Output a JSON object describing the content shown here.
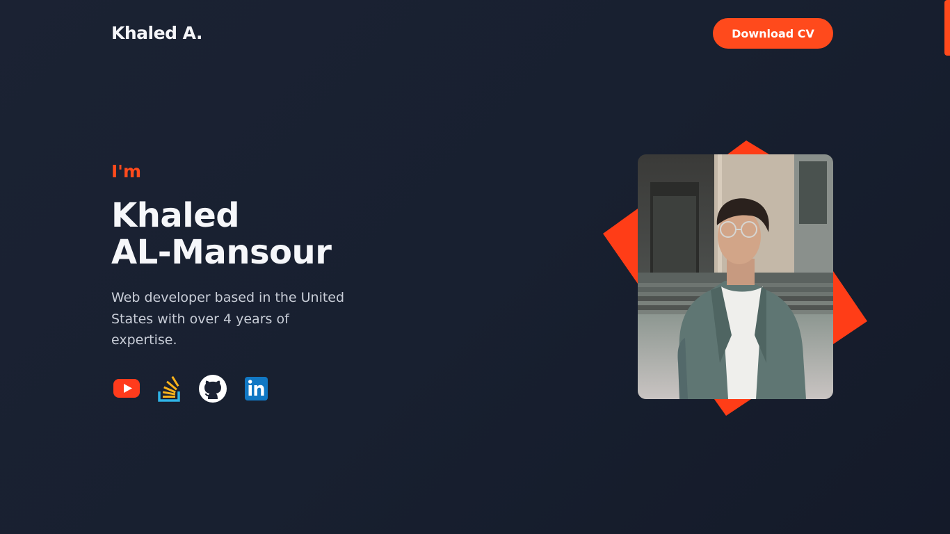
{
  "header": {
    "logo": "Khaled A.",
    "download_label": "Download CV"
  },
  "hero": {
    "intro": "I'm",
    "name_line1": "Khaled",
    "name_line2": "AL-Mansour",
    "bio": "Web developer based in the United States with over 4 years of expertise."
  },
  "socials": [
    {
      "icon": "youtube-icon"
    },
    {
      "icon": "stackoverflow-icon"
    },
    {
      "icon": "github-icon"
    },
    {
      "icon": "linkedin-icon"
    }
  ],
  "colors": {
    "accent": "#ff4a1c",
    "background": "#1b2233",
    "text": "#f6f7fa",
    "muted": "#c9ced8"
  }
}
